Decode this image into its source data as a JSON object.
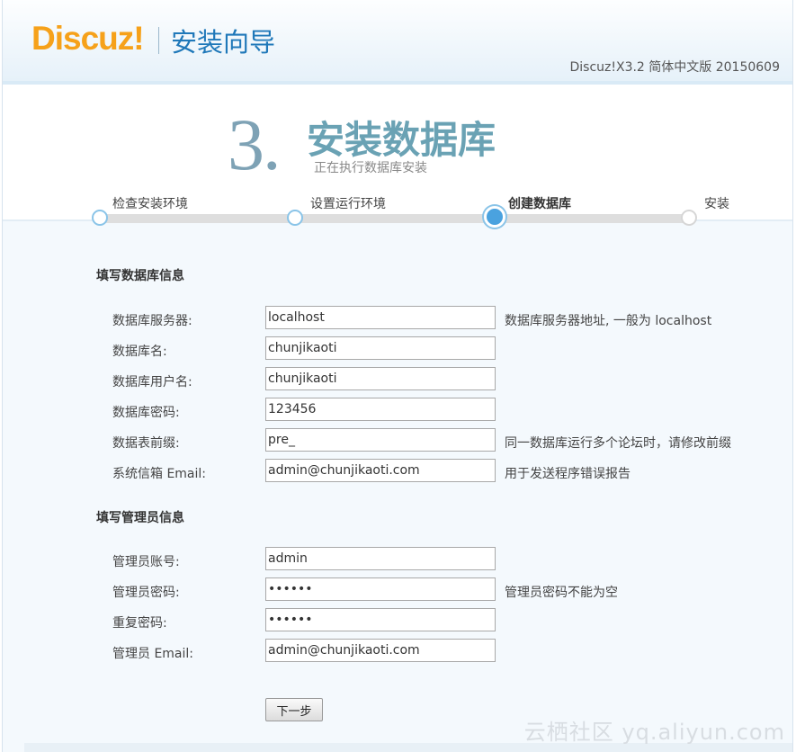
{
  "header": {
    "logo_text": "Discuz!",
    "wizard_title": "安装向导",
    "version": "Discuz!X3.2 简体中文版 20150609"
  },
  "stage": {
    "number": "3.",
    "title": "安装数据库",
    "subtitle": "正在执行数据库安装"
  },
  "steps": [
    {
      "label": "检查安装环境",
      "state": "done"
    },
    {
      "label": "设置运行环境",
      "state": "done"
    },
    {
      "label": "创建数据库",
      "state": "active"
    },
    {
      "label": "安装",
      "state": "todo"
    }
  ],
  "db_section": {
    "title": "填写数据库信息",
    "rows": [
      {
        "label": "数据库服务器:",
        "value": "localhost",
        "hint": "数据库服务器地址, 一般为 localhost"
      },
      {
        "label": "数据库名:",
        "value": "chunjikaoti",
        "hint": ""
      },
      {
        "label": "数据库用户名:",
        "value": "chunjikaoti",
        "hint": ""
      },
      {
        "label": "数据库密码:",
        "value": "123456",
        "hint": ""
      },
      {
        "label": "数据表前缀:",
        "value": "pre_",
        "hint": "同一数据库运行多个论坛时，请修改前缀"
      },
      {
        "label": "系统信箱 Email:",
        "value": "admin@chunjikaoti.com",
        "hint": "用于发送程序错误报告"
      }
    ]
  },
  "admin_section": {
    "title": "填写管理员信息",
    "rows": [
      {
        "label": "管理员账号:",
        "value": "admin",
        "hint": ""
      },
      {
        "label": "管理员密码:",
        "value": "••••••",
        "hint": "管理员密码不能为空"
      },
      {
        "label": "重复密码:",
        "value": "••••••",
        "hint": ""
      },
      {
        "label": "管理员 Email:",
        "value": "admin@chunjikaoti.com",
        "hint": ""
      }
    ]
  },
  "next_button": "下一步",
  "watermark": "云栖社区 yq.aliyun.com"
}
